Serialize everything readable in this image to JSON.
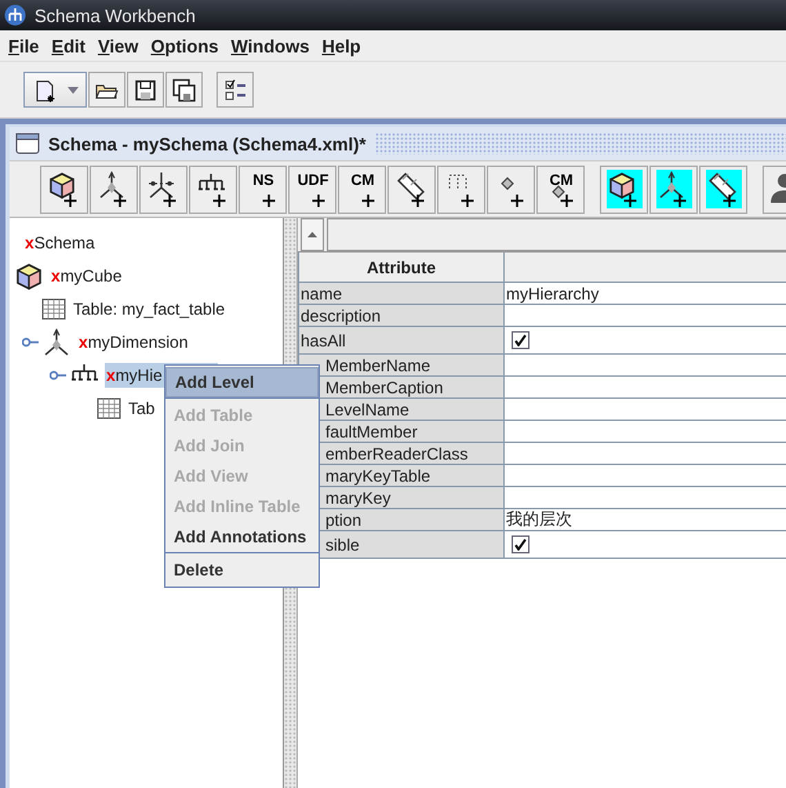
{
  "window": {
    "title": "Schema Workbench"
  },
  "menu_bar": [
    "File",
    "Edit",
    "View",
    "Options",
    "Windows",
    "Help"
  ],
  "main_toolbar": [
    {
      "dropdown": true
    },
    {
      "dropdown": false
    },
    {
      "dropdown": false
    },
    {
      "dropdown": false
    },
    {
      "dropdown": false
    }
  ],
  "document": {
    "title": "Schema - mySchema (Schema4.xml)*",
    "toolbar": [
      {
        "highlighted": false
      },
      {
        "highlighted": false
      },
      {
        "highlighted": false
      },
      {
        "highlighted": false
      },
      {
        "text": "NS",
        "highlighted": false
      },
      {
        "text": "UDF",
        "highlighted": false
      },
      {
        "text": "CM",
        "highlighted": false
      },
      {
        "highlighted": false
      },
      {
        "highlighted": false
      },
      {
        "highlighted": false
      },
      {
        "text": "CM",
        "highlighted": false
      },
      {
        "highlighted": true
      },
      {
        "highlighted": true
      },
      {
        "highlighted": true
      },
      {
        "highlighted": false
      }
    ],
    "tree": {
      "mark": "x",
      "label": "Schema",
      "children": [
        {
          "kind": "cube",
          "mark": "x",
          "label": "myCube",
          "children": [
            {
              "kind": "table",
              "label": "Table: my_fact_table"
            },
            {
              "kind": "dimension",
              "mark": "x",
              "label": "myDimension",
              "expanded": true,
              "children": [
                {
                  "kind": "hierarchy",
                  "mark": "x",
                  "label": "myHie",
                  "selected": true,
                  "expanded": true,
                  "children": [
                    {
                      "kind": "table",
                      "label": "Tab"
                    }
                  ]
                }
              ]
            }
          ]
        }
      ]
    },
    "context_menu": [
      {
        "label": "Add Level",
        "disabled": false,
        "selected": true,
        "separator_after": true
      },
      {
        "label": "Add Table",
        "disabled": true,
        "selected": false,
        "separator_after": false
      },
      {
        "label": "Add Join",
        "disabled": true,
        "selected": false,
        "separator_after": false
      },
      {
        "label": "Add View",
        "disabled": true,
        "selected": false,
        "separator_after": false
      },
      {
        "label": "Add Inline Table",
        "disabled": true,
        "selected": false,
        "separator_after": false
      },
      {
        "label": "Add Annotations",
        "disabled": false,
        "selected": false,
        "separator_after": true
      },
      {
        "label": "Delete",
        "disabled": false,
        "selected": false,
        "separator_after": false
      }
    ],
    "table": {
      "columns": [
        "Attribute"
      ],
      "rows": [
        {
          "attribute": "name",
          "covered": false,
          "kind": "text",
          "value": "myHierarchy"
        },
        {
          "attribute": "description",
          "covered": false,
          "kind": "text"
        },
        {
          "attribute": "hasAll",
          "covered": false,
          "kind": "check",
          "checked": true
        },
        {
          "attribute": "MemberName",
          "covered": true,
          "kind": "text"
        },
        {
          "attribute": "MemberCaption",
          "covered": true,
          "kind": "text"
        },
        {
          "attribute": "LevelName",
          "covered": true,
          "kind": "text"
        },
        {
          "attribute": "faultMember",
          "covered": true,
          "kind": "text"
        },
        {
          "attribute": "emberReaderClass",
          "covered": true,
          "kind": "text"
        },
        {
          "attribute": "maryKeyTable",
          "covered": true,
          "kind": "text"
        },
        {
          "attribute": "maryKey",
          "covered": true,
          "kind": "text"
        },
        {
          "attribute": "ption",
          "covered": true,
          "kind": "text",
          "value": "我的层次"
        },
        {
          "attribute": "sible",
          "covered": true,
          "kind": "check",
          "checked": true
        }
      ]
    }
  }
}
